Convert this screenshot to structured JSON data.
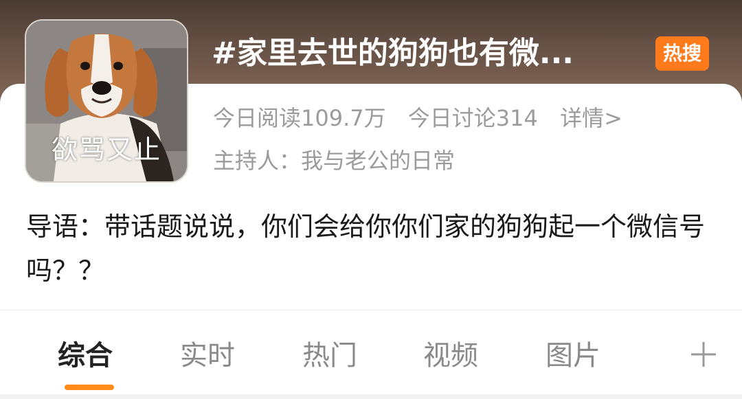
{
  "topic": {
    "title": "#家里去世的狗狗也有微...",
    "hot_badge": "热搜",
    "avatar_caption": "欲骂又止",
    "stats": {
      "reads": "今日阅读109.7万",
      "discussions": "今日讨论314",
      "details_link": "详情>"
    },
    "host": "主持人：我与老公的日常"
  },
  "intro": "导语：带话题说说，你们会给你你们家的狗狗起一个微信号吗？？",
  "tabs": [
    {
      "label": "综合",
      "active": true
    },
    {
      "label": "实时",
      "active": false
    },
    {
      "label": "热门",
      "active": false
    },
    {
      "label": "视频",
      "active": false
    },
    {
      "label": "图片",
      "active": false
    }
  ],
  "icons": {
    "add": "plus-icon"
  },
  "colors": {
    "accent": "#ff8c1a",
    "hot_badge": "#ff7a1a",
    "muted_text": "#9b9b9b",
    "active_tab": "#222222"
  }
}
